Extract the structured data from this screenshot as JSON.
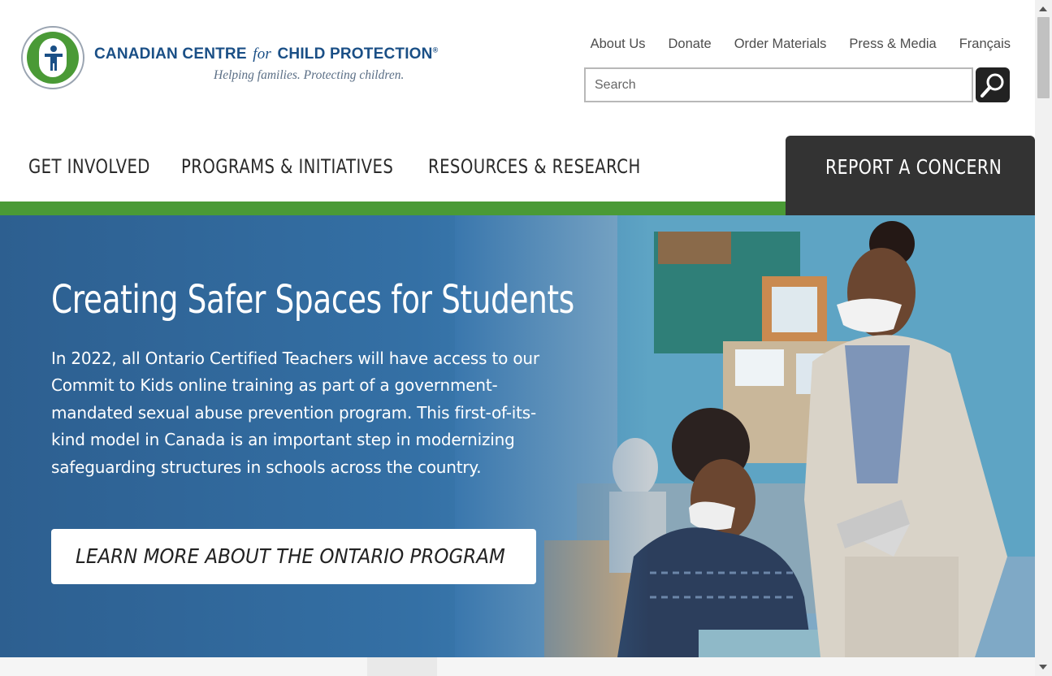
{
  "logo": {
    "name_part1": "CANADIAN CENTRE",
    "name_for": "for",
    "name_part2": "CHILD PROTECTION",
    "registered": "®",
    "tagline": "Helping families. Protecting children."
  },
  "utility_nav": [
    "About Us",
    "Donate",
    "Order Materials",
    "Press & Media",
    "Français"
  ],
  "search": {
    "placeholder": "Search",
    "icon": "search-icon"
  },
  "main_nav": [
    "GET INVOLVED",
    "PROGRAMS & INITIATIVES",
    "RESOURCES & RESEARCH"
  ],
  "report_button": "REPORT A CONCERN",
  "hero": {
    "title": "Creating Safer Spaces for Students",
    "body": "In 2022, all Ontario Certified Teachers will have access to our Commit to Kids online training as part of a government-mandated sexual abuse prevention program. This first-of-its-kind model in Canada is an important step in modernizing safeguarding structures in schools across the country.",
    "cta": "LEARN MORE ABOUT THE ONTARIO PROGRAM"
  },
  "colors": {
    "brand_blue": "#1a4f86",
    "brand_green": "#4a9a36",
    "dark": "#333333",
    "hero_blue": "#3470a5"
  }
}
